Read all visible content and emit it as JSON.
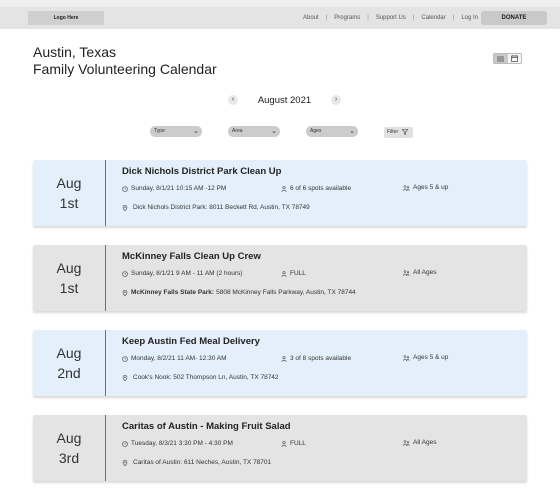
{
  "header": {
    "logo": "Logo Here",
    "nav": [
      "About",
      "Programs",
      "Support Us",
      "Calendar",
      "Log In"
    ],
    "donate": "DONATE"
  },
  "page": {
    "location": "Austin, Texas",
    "title": "Family Volunteering Calendar",
    "view_toggle": {
      "options": [
        "list-icon",
        "calendar-icon"
      ],
      "active": "list-icon"
    }
  },
  "month_nav": {
    "prev": "‹",
    "label": "August 2021",
    "next": "›"
  },
  "filters": {
    "type": "Type",
    "area": "Area",
    "ages": "Ages",
    "filter_button": "Filter"
  },
  "colors": {
    "blue_card": "#e3f0fc",
    "gray_card": "#e4e4e4"
  },
  "events": [
    {
      "month": "Aug",
      "day": "1st",
      "name": "Dick Nichols District Park Clean Up",
      "time": "Sunday, 8/1/21 10:15 AM -12 PM",
      "spots": "6 of 6 spots available",
      "ages": "Ages 5 & up",
      "location_bold": "",
      "location": "Dick Nichols District Park: 8011 Beckett Rd, Austin, TX 78749"
    },
    {
      "month": "Aug",
      "day": "1st",
      "name": "McKinney Falls Clean Up Crew",
      "time": "Sunday, 8/1/21 9 AM - 11 AM (2 hours)",
      "spots": "FULL",
      "ages": "All Ages",
      "location_bold": "McKinney Falls State Park:",
      "location": "5808 McKinney Falls Parkway, Austin, TX 78744"
    },
    {
      "month": "Aug",
      "day": "2nd",
      "name": "Keep Austin Fed Meal Delivery",
      "time": "Monday, 8/2/21 11 AM- 12:30 AM",
      "spots": "3 of 8 spots available",
      "ages": "Ages 5 & up",
      "location_bold": "",
      "location": "Cook's Nook: 502 Thompson Ln, Austin, TX 78742"
    },
    {
      "month": "Aug",
      "day": "3rd",
      "name": "Caritas of Austin - Making Fruit Salad",
      "time": "Tuesday, 8/3/21 3:30 PM - 4:30 PM",
      "spots": "FULL",
      "ages": "All Ages",
      "location_bold": "",
      "location": "Caritas of Austin: 611 Neches, Austin, TX 78701"
    }
  ]
}
